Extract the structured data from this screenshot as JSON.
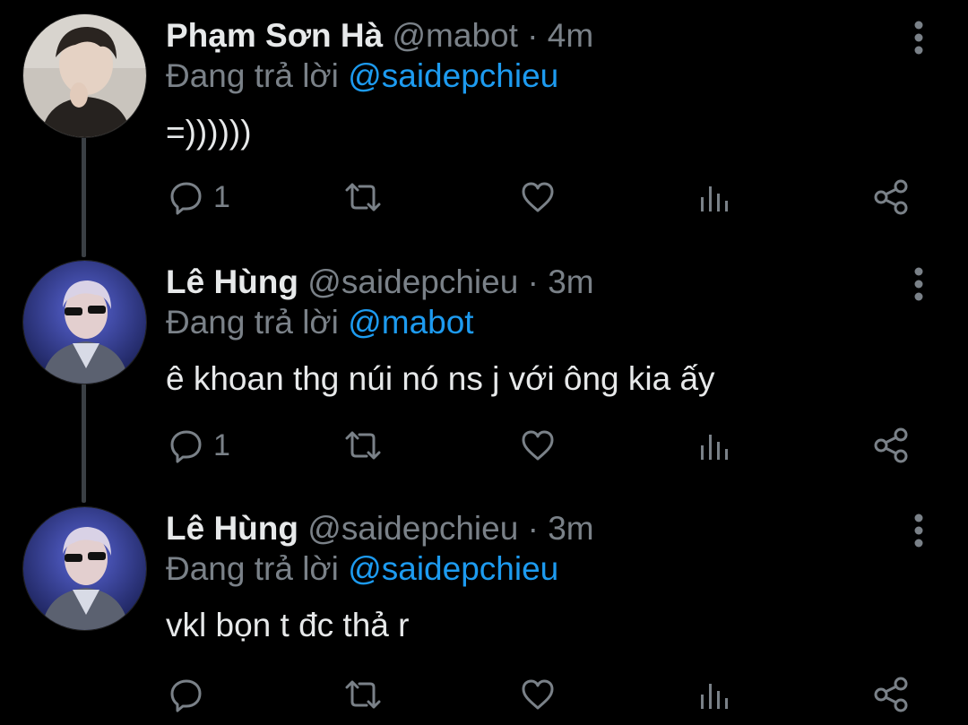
{
  "colors": {
    "background": "#000000",
    "text": "#e7e9ea",
    "muted": "#7a8188",
    "accent": "#1d9bf0"
  },
  "tweets": [
    {
      "name": "Phạm Sơn Hà",
      "handle": "@mabot",
      "separator": "·",
      "time": "4m",
      "replying_label": "Đang trả lời",
      "replying_to": "@saidepchieu",
      "text": "=))))))",
      "reply_count": "1",
      "avatar_icon": "profile-photo"
    },
    {
      "name": "Lê Hùng",
      "handle": "@saidepchieu",
      "separator": "·",
      "time": "3m",
      "replying_label": "Đang trả lời",
      "replying_to": "@mabot",
      "text": "ê khoan thg núi nó ns j với ông kia ấy",
      "reply_count": "1",
      "avatar_icon": "profile-photo"
    },
    {
      "name": "Lê Hùng",
      "handle": "@saidepchieu",
      "separator": "·",
      "time": "3m",
      "replying_label": "Đang trả lời",
      "replying_to": "@saidepchieu",
      "text": "vkl bọn t đc thả r",
      "reply_count": "",
      "avatar_icon": "profile-photo"
    }
  ],
  "action_icons": [
    "reply-icon",
    "retweet-icon",
    "like-icon",
    "analytics-icon",
    "share-icon",
    "more-icon"
  ]
}
